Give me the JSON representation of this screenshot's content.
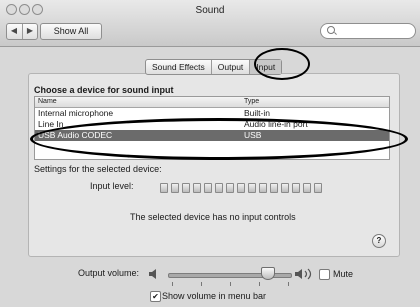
{
  "window": {
    "title": "Sound"
  },
  "toolbar": {
    "back_glyph": "◀",
    "forward_glyph": "▶",
    "show_all_label": "Show All",
    "search_placeholder": ""
  },
  "tabs": [
    {
      "label": "Sound Effects",
      "selected": false
    },
    {
      "label": "Output",
      "selected": false
    },
    {
      "label": "Input",
      "selected": true
    }
  ],
  "input": {
    "heading": "Choose a device for sound input",
    "columns": [
      "Name",
      "Type"
    ],
    "rows": [
      {
        "name": "Internal microphone",
        "type": "Built-in",
        "selected": false
      },
      {
        "name": "Line In",
        "type": "Audio line-in port",
        "selected": false
      },
      {
        "name": "USB Audio CODEC",
        "type": "USB",
        "selected": true
      }
    ],
    "settings_label": "Settings for the selected device:",
    "input_level_label": "Input level:",
    "input_level_segments": 15,
    "no_controls_text": "The selected device has no input controls",
    "help_label": "?"
  },
  "footer": {
    "output_volume_label": "Output volume:",
    "output_volume_fraction": 0.82,
    "mute_label": "Mute",
    "mute_checked": false,
    "show_volume_label": "Show volume in menu bar",
    "show_volume_checked": true
  },
  "icons": {
    "speaker_quiet": "speaker-quiet-icon",
    "speaker_loud": "speaker-loud-icon",
    "search": "search-icon",
    "help": "help-icon"
  },
  "colors": {
    "selected_row": "#6b6b6b",
    "annotation": "#000000"
  }
}
